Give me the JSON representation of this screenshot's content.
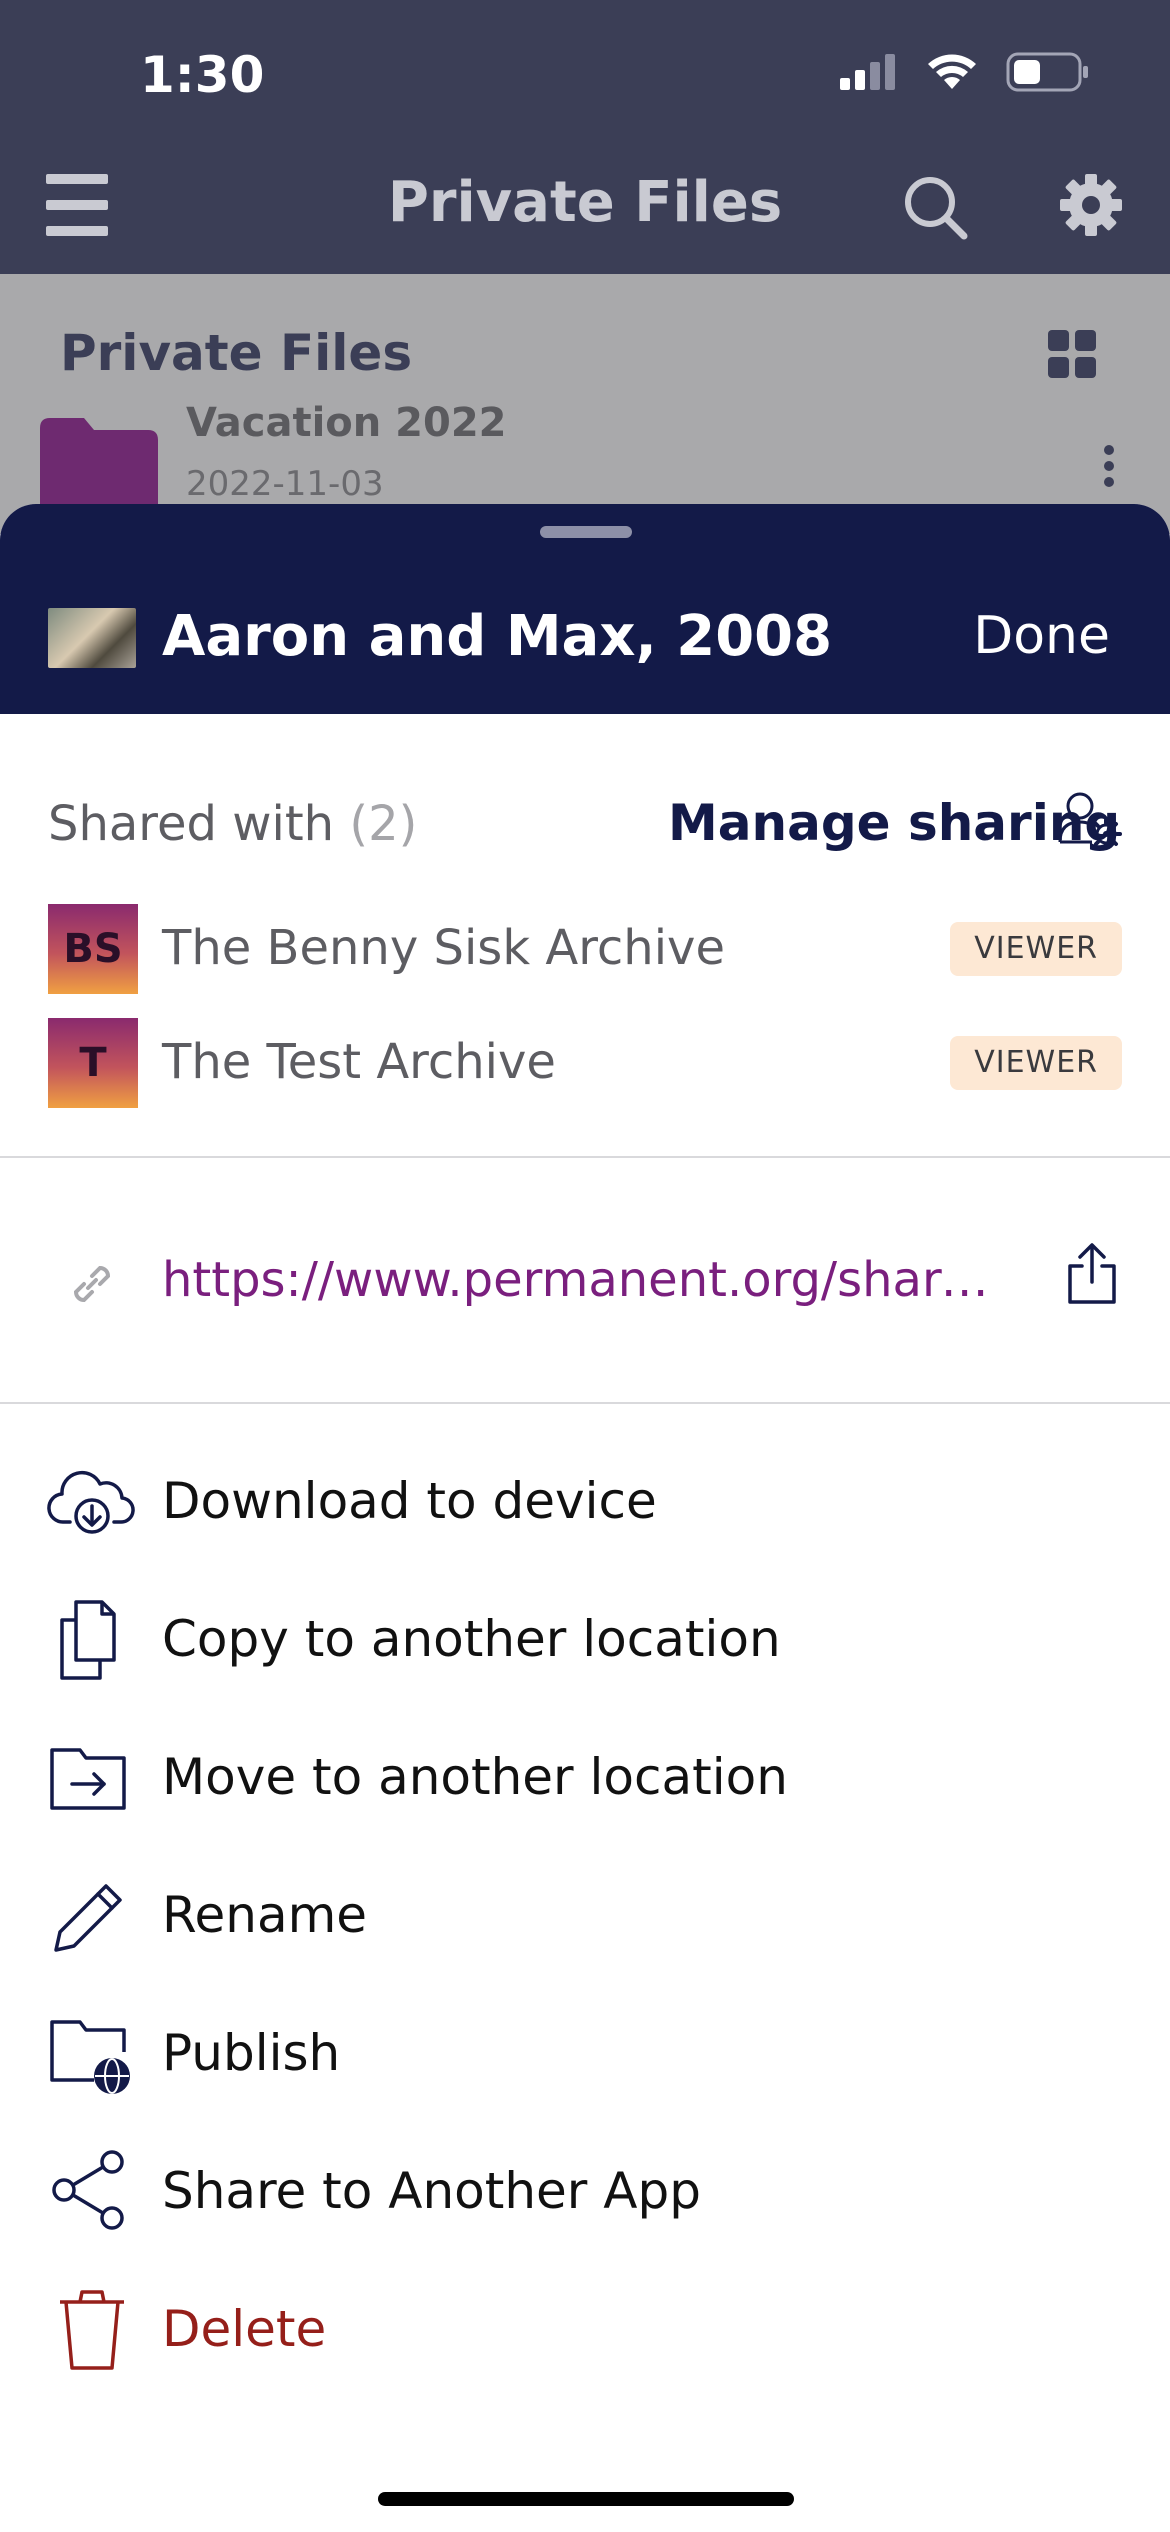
{
  "status": {
    "time": "1:30"
  },
  "nav": {
    "title": "Private Files"
  },
  "files": {
    "section_title": "Private Files",
    "folder": {
      "name": "Vacation 2022",
      "date": "2022-11-03"
    }
  },
  "sheet": {
    "title": "Aaron and Max, 2008",
    "done_label": "Done",
    "shared_with_label": "Shared with",
    "shared_count": "(2)",
    "manage_label": "Manage sharing",
    "shares": [
      {
        "initials": "BS",
        "name": "The Benny Sisk Archive",
        "role": "VIEWER"
      },
      {
        "initials": "T",
        "name": "The Test Archive",
        "role": "VIEWER"
      }
    ],
    "share_link": "https://www.permanent.org/share/...",
    "actions": [
      {
        "label": "Download to device",
        "icon": "cloud-download-icon"
      },
      {
        "label": "Copy to another location",
        "icon": "copy-icon"
      },
      {
        "label": "Move to another location",
        "icon": "move-folder-icon"
      },
      {
        "label": "Rename",
        "icon": "pencil-icon"
      },
      {
        "label": "Publish",
        "icon": "folder-globe-icon"
      },
      {
        "label": "Share to Another App",
        "icon": "share-nodes-icon"
      },
      {
        "label": "Delete",
        "icon": "trash-icon"
      }
    ]
  },
  "colors": {
    "nav_bg": "#3b3e56",
    "sheet_header_bg": "#131a48",
    "link": "#7a1f7e",
    "danger": "#951f1a",
    "badge_bg": "#fde8d4"
  }
}
